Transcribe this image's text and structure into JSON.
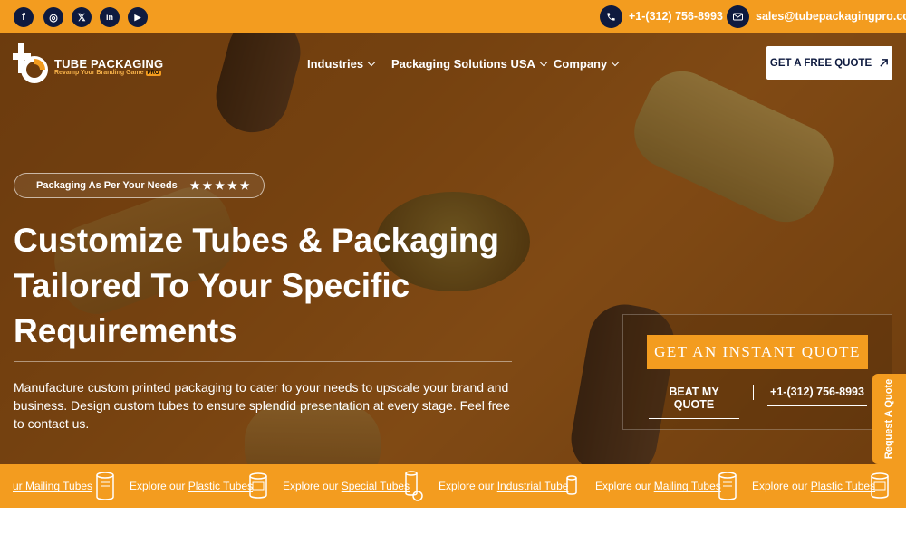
{
  "topbar": {
    "social": [
      {
        "name": "facebook-icon",
        "glyph": "f"
      },
      {
        "name": "instagram-icon",
        "glyph": "◎"
      },
      {
        "name": "x-icon",
        "glyph": "𝕏"
      },
      {
        "name": "linkedin-icon",
        "glyph": "in"
      },
      {
        "name": "youtube-icon",
        "glyph": "▶"
      }
    ],
    "phone": "+1-(312) 756-8993",
    "email": "sales@tubepackagingpro.com"
  },
  "header": {
    "logo_title": "TUBE PACKAGING",
    "logo_subtitle": "Revamp Your Branding Game",
    "logo_pro": "PRO",
    "nav": [
      {
        "label": "Industries"
      },
      {
        "label": "Packaging Solutions USA"
      },
      {
        "label": "Company"
      }
    ],
    "quote_button": "GET A FREE QUOTE"
  },
  "hero": {
    "badge_text": "Packaging As Per Your Needs",
    "stars": "★★★★★",
    "headline": "Customize Tubes & Packaging Tailored To Your Specific Requirements",
    "description": "Manufacture custom printed packaging to cater to your needs to upscale your brand and business. Design custom tubes to ensure splendid presentation at every stage. Feel free to contact us.",
    "instant_quote": "GET AN INSTANT QUOTE",
    "beat_quote": "BEAT MY QUOTE",
    "phone": "+1-(312) 756-8993"
  },
  "side_tab": "Request A Quote",
  "ticker": {
    "items": [
      {
        "prefix": "",
        "link": "ur Mailing Tubes"
      },
      {
        "prefix": "Explore our ",
        "link": "Plastic Tubes"
      },
      {
        "prefix": "Explore our ",
        "link": "Special Tubes"
      },
      {
        "prefix": "Explore our ",
        "link": "Industrial Tube"
      },
      {
        "prefix": "Explore our ",
        "link": "Mailing Tubes"
      },
      {
        "prefix": "Explore our ",
        "link": "Plastic Tubes"
      }
    ]
  },
  "colors": {
    "accent": "#f39c1f",
    "navy": "#0e1a3f"
  }
}
